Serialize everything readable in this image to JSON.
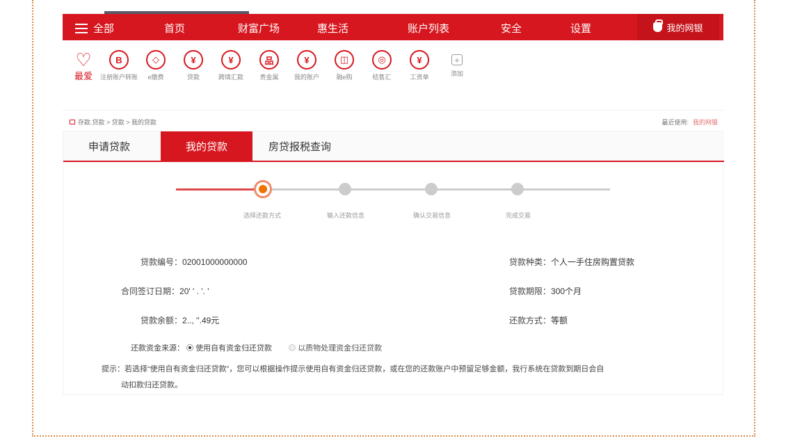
{
  "nav": {
    "items": [
      {
        "label": "全部"
      },
      {
        "label": "首页"
      },
      {
        "label": "财富广场"
      },
      {
        "label": "惠生活"
      },
      {
        "label": "账户列表"
      },
      {
        "label": "安全"
      },
      {
        "label": "设置"
      }
    ],
    "mybank": "我的网银"
  },
  "quick": {
    "favorite": "最爱",
    "items": [
      {
        "icon": "B",
        "label": "注册账户转账"
      },
      {
        "icon": "◇",
        "label": "e缴费"
      },
      {
        "icon": "¥",
        "label": "贷款"
      },
      {
        "icon": "¥",
        "label": "跨境汇款"
      },
      {
        "icon": "品",
        "label": "贵金属"
      },
      {
        "icon": "¥",
        "label": "我的账户"
      },
      {
        "icon": "◫",
        "label": "融e购"
      },
      {
        "icon": "◎",
        "label": "结售汇"
      },
      {
        "icon": "¥",
        "label": "工资单"
      },
      {
        "icon": "+",
        "label": "添加"
      }
    ]
  },
  "breadcrumb": "存款.贷款 > 贷款 > 我的贷款",
  "recent": {
    "label": "最近使用:",
    "link": "我的网银"
  },
  "tabs": [
    {
      "label": "申请贷款"
    },
    {
      "label": "我的贷款"
    },
    {
      "label": "房贷报税查询"
    }
  ],
  "steps": [
    {
      "label": "选择还款方式"
    },
    {
      "label": "输入还款信息"
    },
    {
      "label": "确认交易信息"
    },
    {
      "label": "完成交易"
    }
  ],
  "form": {
    "loan_no_label": "贷款编号：",
    "loan_no": "02001000000000",
    "loan_type_label": "贷款种类：",
    "loan_type": "个人一手住房购置贷款",
    "sign_date_label": "合同签订日期：",
    "sign_date": "20' ' . '. ' ",
    "term_label": "贷款期限：",
    "term": "300个月",
    "balance_label": "贷款余额：",
    "balance": "2.., ''.49元",
    "method_label": "还款方式：",
    "method": "等额",
    "source_label": "还款资金来源：",
    "source_opt1": "使用自有资金归还贷款",
    "source_opt2": "以质物处理资金归还贷款",
    "tip_prefix": "提示：",
    "tip_line1": "若选择“使用自有资金归还贷款”，您可以根据操作提示使用自有资金归还贷款，或在您的还款账户中预留足够金额，我行系统在贷款到期日会自",
    "tip_line2": "动扣款归还贷款。"
  },
  "colors": {
    "brand_red": "#d7171f",
    "step_orange": "#ee7300"
  }
}
